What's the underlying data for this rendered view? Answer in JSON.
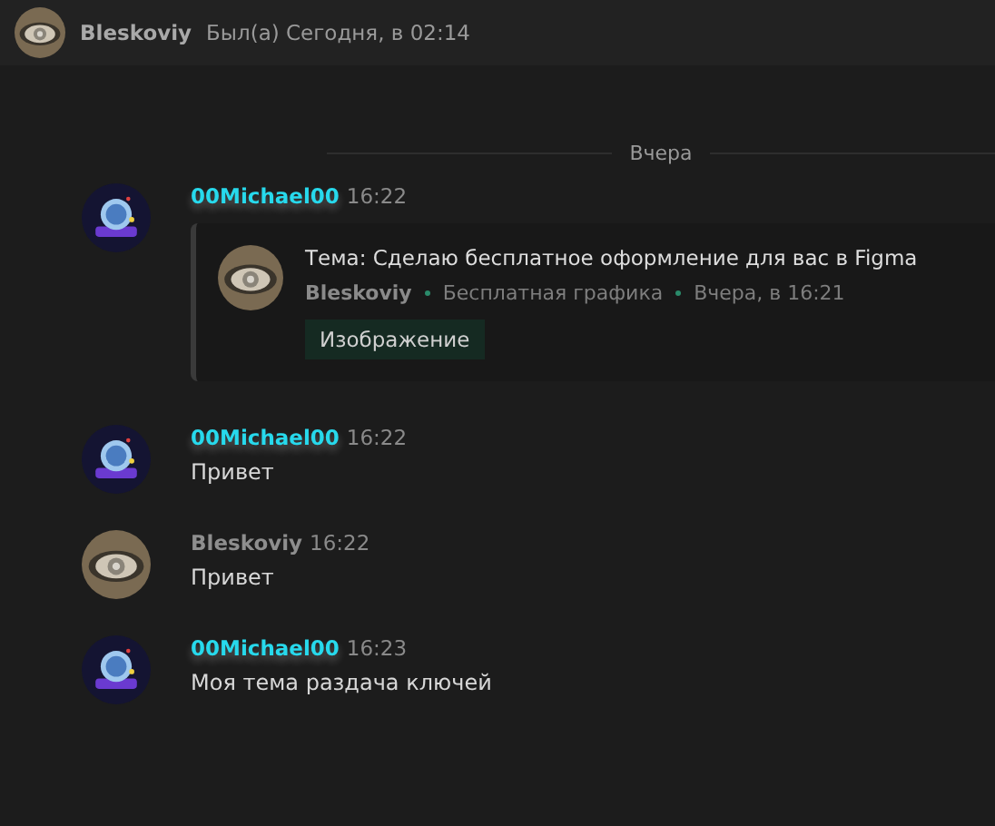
{
  "header": {
    "avatar": {
      "kind": "eye"
    },
    "name": "Bleskoviy",
    "status": "Был(а) Сегодня, в 02:14"
  },
  "divider": "Вчера",
  "messages": [
    {
      "author": "00Michael00",
      "highlighted": true,
      "avatar": {
        "kind": "coin"
      },
      "time": "16:22",
      "kind": "topic",
      "topic": {
        "title": "Тема: Сделаю бесплатное оформление для вас в Figma",
        "author": "Bleskoviy",
        "forum": "Бесплатная графика",
        "date": "Вчера, в 16:21",
        "tag": "Изображение",
        "avatar": {
          "kind": "eye"
        }
      }
    },
    {
      "author": "00Michael00",
      "highlighted": true,
      "avatar": {
        "kind": "coin"
      },
      "time": "16:22",
      "kind": "text",
      "text": "Привет"
    },
    {
      "author": "Bleskoviy",
      "highlighted": false,
      "avatar": {
        "kind": "eye"
      },
      "time": "16:22",
      "kind": "text",
      "text": "Привет"
    },
    {
      "author": "00Michael00",
      "highlighted": true,
      "avatar": {
        "kind": "coin"
      },
      "time": "16:23",
      "kind": "text",
      "text": "Моя тема раздача ключей"
    }
  ]
}
